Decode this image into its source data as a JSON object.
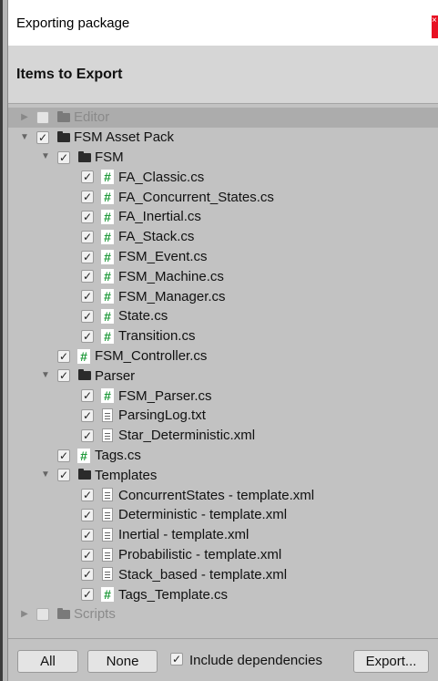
{
  "window": {
    "title": "Exporting package",
    "close_label": "×"
  },
  "header": {
    "heading": "Items to Export"
  },
  "tree": {
    "rows": [
      {
        "label": "Editor",
        "icon": "folder-icon",
        "checked": false
      },
      {
        "label": "FSM Asset Pack",
        "icon": "folder-icon",
        "checked": true
      },
      {
        "label": "FSM",
        "icon": "folder-icon",
        "checked": true
      },
      {
        "label": "FA_Classic.cs",
        "icon": "csharp-script-icon",
        "checked": true
      },
      {
        "label": "FA_Concurrent_States.cs",
        "icon": "csharp-script-icon",
        "checked": true
      },
      {
        "label": "FA_Inertial.cs",
        "icon": "csharp-script-icon",
        "checked": true
      },
      {
        "label": "FA_Stack.cs",
        "icon": "csharp-script-icon",
        "checked": true
      },
      {
        "label": "FSM_Event.cs",
        "icon": "csharp-script-icon",
        "checked": true
      },
      {
        "label": "FSM_Machine.cs",
        "icon": "csharp-script-icon",
        "checked": true
      },
      {
        "label": "FSM_Manager.cs",
        "icon": "csharp-script-icon",
        "checked": true
      },
      {
        "label": "State.cs",
        "icon": "csharp-script-icon",
        "checked": true
      },
      {
        "label": "Transition.cs",
        "icon": "csharp-script-icon",
        "checked": true
      },
      {
        "label": "FSM_Controller.cs",
        "icon": "csharp-script-icon",
        "checked": true
      },
      {
        "label": "Parser",
        "icon": "folder-icon",
        "checked": true
      },
      {
        "label": "FSM_Parser.cs",
        "icon": "csharp-script-icon",
        "checked": true
      },
      {
        "label": "ParsingLog.txt",
        "icon": "text-file-icon",
        "checked": true
      },
      {
        "label": "Star_Deterministic.xml",
        "icon": "text-file-icon",
        "checked": true
      },
      {
        "label": "Tags.cs",
        "icon": "csharp-script-icon",
        "checked": true
      },
      {
        "label": "Templates",
        "icon": "folder-icon",
        "checked": true
      },
      {
        "label": "ConcurrentStates - template.xml",
        "icon": "text-file-icon",
        "checked": true
      },
      {
        "label": "Deterministic - template.xml",
        "icon": "text-file-icon",
        "checked": true
      },
      {
        "label": "Inertial - template.xml",
        "icon": "text-file-icon",
        "checked": true
      },
      {
        "label": "Probabilistic - template.xml",
        "icon": "text-file-icon",
        "checked": true
      },
      {
        "label": "Stack_based - template.xml",
        "icon": "text-file-icon",
        "checked": true
      },
      {
        "label": "Tags_Template.cs",
        "icon": "csharp-script-icon",
        "checked": true
      },
      {
        "label": "Scripts",
        "icon": "folder-icon",
        "checked": false
      }
    ]
  },
  "footer": {
    "all_label": "All",
    "none_label": "None",
    "include_dependencies_label": "Include dependencies",
    "include_dependencies_checked": true,
    "export_label": "Export..."
  },
  "glyphs": {
    "check": "✓",
    "expanded": "▼",
    "collapsed": "▶",
    "cs": "#"
  }
}
